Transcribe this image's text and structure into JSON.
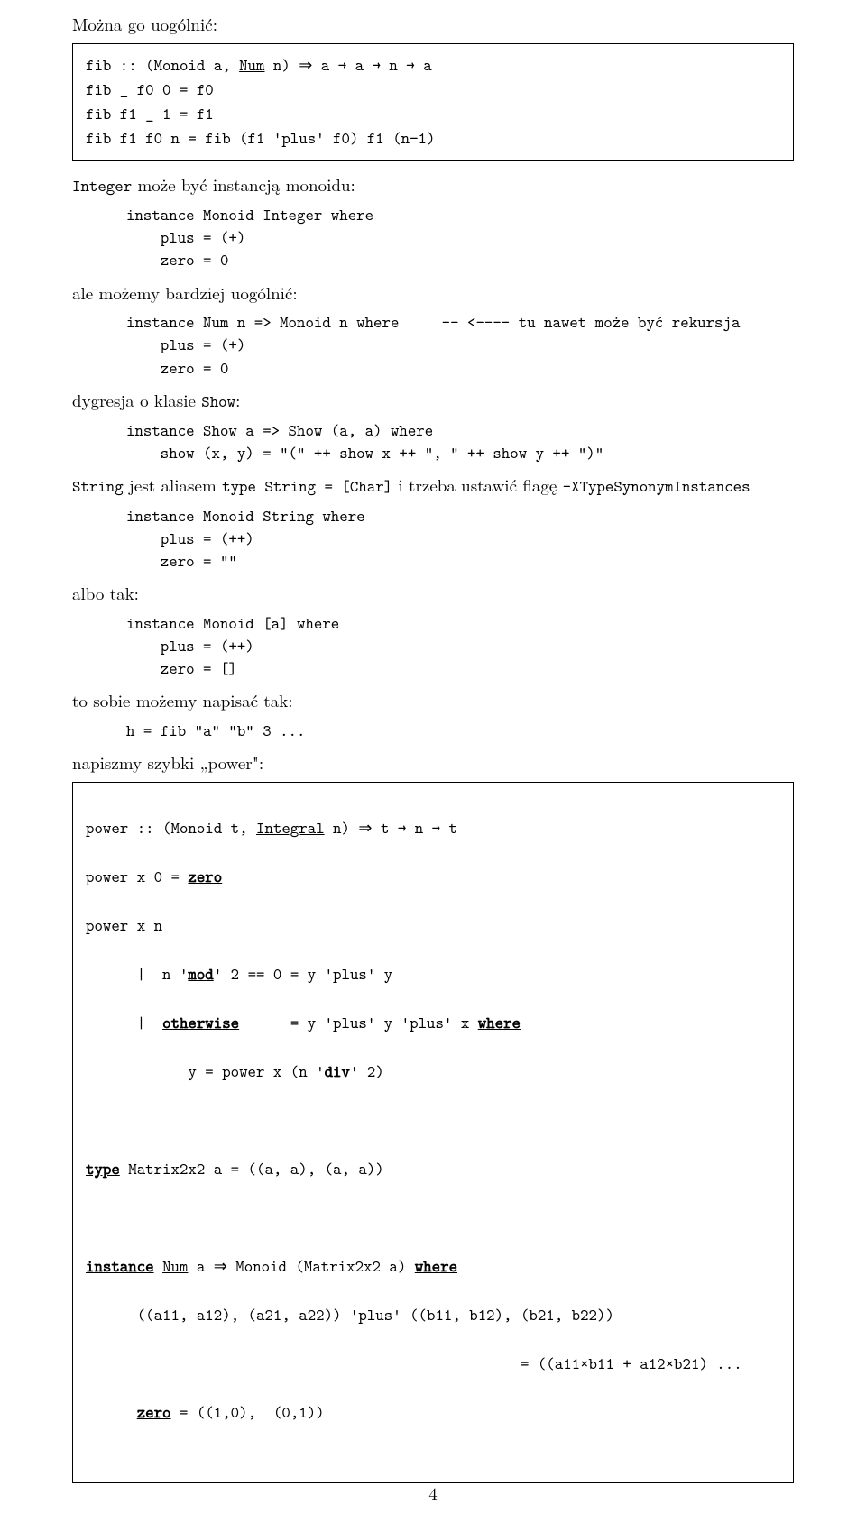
{
  "p1": "Można go uogólnić:",
  "box1": {
    "l1a": "fib :: (Monoid a, ",
    "l1b": "Num",
    "l1c": " n) ⇒ a → a → n → a",
    "l2": "fib _ f0 0 = f0",
    "l3": "fib f1 _ 1 = f1",
    "l4": "fib f1 f0 n = fib (f1 'plus' f0) f1 (n−1)"
  },
  "p2a": "Integer",
  "p2b": " może być instancją monoidu:",
  "code1": "instance Monoid Integer where\n    plus = (+)\n    zero = 0",
  "p3": "ale możemy bardziej uogólnić:",
  "code2": "instance Num n => Monoid n where     -- <---- tu nawet może być rekursja\n    plus = (+)\n    zero = 0",
  "p4a": "dygresja o klasie ",
  "p4b": "Show",
  "p4c": ":",
  "code3": "instance Show a => Show (a, a) where\n    show (x, y) = \"(\" ++ show x ++ \", \" ++ show y ++ \")\"",
  "p5a": "String",
  "p5b": " jest aliasem ",
  "p5c": "type String = [Char]",
  "p5d": " i trzeba ustawić flagę ",
  "p5e": "-XTypeSynonymInstances",
  "code4": "instance Monoid String where\n    plus = (++)\n    zero = \"\"",
  "p6": "albo tak:",
  "code5": "instance Monoid [a] where\n    plus = (++)\n    zero = []",
  "p7": "to sobie możemy napisać tak:",
  "code6": "h = fib \"a\" \"b\" 3 ...",
  "p8": "napiszmy szybki „power\":",
  "box2": {
    "l1a": "power :: (Monoid t, ",
    "l1b": "Integral",
    "l1c": " n) ⇒ t → n → t",
    "l2a": "power x 0 = ",
    "l2b": "zero",
    "l3": "power x n",
    "l4a": "      |  n '",
    "l4b": "mod",
    "l4c": "' 2 == 0 = y 'plus' y",
    "l5a": "      |  ",
    "l5b": "otherwise",
    "l5c": "      = y 'plus' y 'plus' x ",
    "l5d": "where",
    "l6a": "            y = power x (n '",
    "l6b": "div",
    "l6c": "' 2)",
    "blank1": " ",
    "l7a": "type",
    "l7b": " Matrix2x2 a = ((a, a), (a, a))",
    "blank2": " ",
    "l8a": "instance",
    "l8b": " ",
    "l8c": "Num",
    "l8d": " a ⇒ Monoid (Matrix2x2 a) ",
    "l8e": "where",
    "l9": "      ((a11, a12), (a21, a22)) 'plus' ((b11, b12), (b21, b22))",
    "l10": "                                                   = ((a11×b11 + a12×b21) ...",
    "l11a": "      ",
    "l11b": "zero",
    "l11c": " = ((1,0),  (0,1))"
  },
  "pagenum": "4"
}
